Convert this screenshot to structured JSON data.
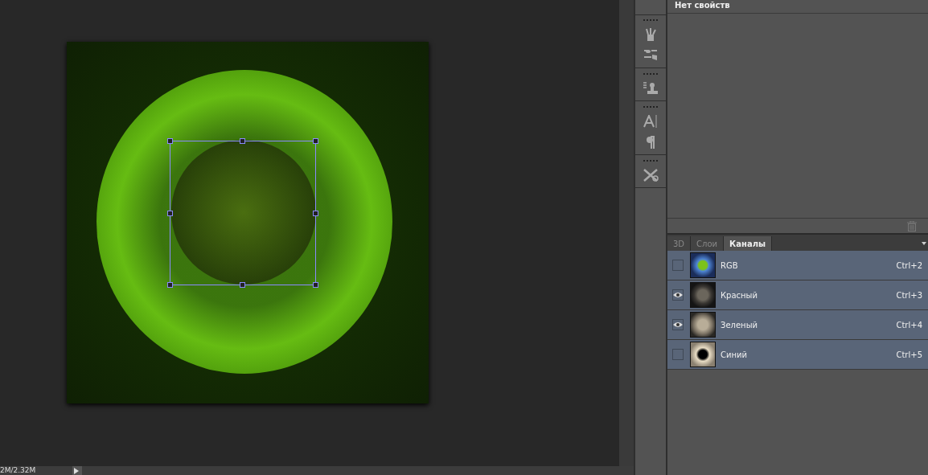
{
  "properties": {
    "title": "Нет свойств"
  },
  "status_bar": {
    "doc_size": "2M/2.32M"
  },
  "tool_groups": [
    {
      "tools": [
        {
          "kind": "brushes"
        },
        {
          "kind": "brush-settings"
        }
      ]
    },
    {
      "tools": [
        {
          "kind": "clone-source"
        }
      ]
    },
    {
      "tools": [
        {
          "kind": "character"
        },
        {
          "kind": "paragraph"
        }
      ]
    },
    {
      "tools": [
        {
          "kind": "tools"
        }
      ]
    }
  ],
  "tabs": [
    {
      "label": "3D",
      "selected": false
    },
    {
      "label": "Слои",
      "selected": false
    },
    {
      "label": "Каналы",
      "selected": true
    }
  ],
  "channels": [
    {
      "name": "RGB",
      "shortcut": "Ctrl+2",
      "visible": false,
      "selected": true,
      "kind": "rgb"
    },
    {
      "name": "Красный",
      "shortcut": "Ctrl+3",
      "visible": true,
      "selected": true,
      "kind": "red"
    },
    {
      "name": "Зеленый",
      "shortcut": "Ctrl+4",
      "visible": true,
      "selected": true,
      "kind": "green"
    },
    {
      "name": "Синий",
      "shortcut": "Ctrl+5",
      "visible": false,
      "selected": true,
      "kind": "blue"
    }
  ]
}
